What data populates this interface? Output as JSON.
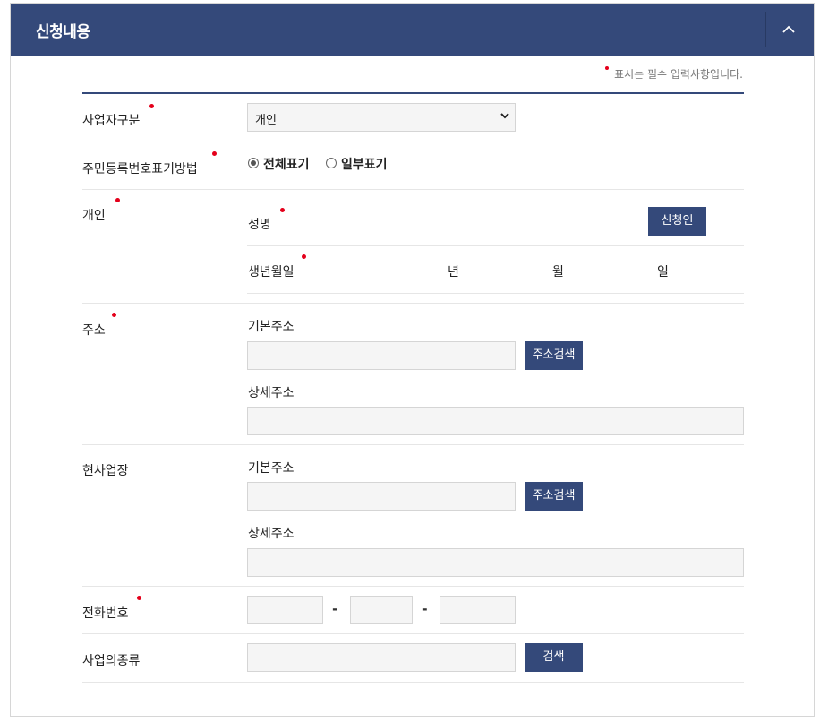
{
  "header": {
    "title": "신청내용",
    "collapse_icon": "chevron-up-icon"
  },
  "required_note": "표시는 필수 입력사항입니다.",
  "colors": {
    "header_bg": "#34497a",
    "button_bg": "#34497a",
    "required_dot": "#e4001b"
  },
  "business_type": {
    "label": "사업자구분",
    "selected": "개인"
  },
  "rrn_display": {
    "label": "주민등록번호표기방법",
    "options": [
      "전체표기",
      "일부표기"
    ],
    "selected": "전체표기"
  },
  "individual": {
    "label": "개인",
    "name_label": "성명",
    "applicant_button": "신청인",
    "birth_label": "생년월일",
    "year": "년",
    "month": "월",
    "day": "일"
  },
  "address": {
    "label": "주소",
    "basic_label": "기본주소",
    "search_button": "주소검색",
    "detail_label": "상세주소"
  },
  "workplace": {
    "label": "현사업장",
    "basic_label": "기본주소",
    "search_button": "주소검색",
    "detail_label": "상세주소"
  },
  "phone": {
    "label": "전화번호",
    "separator": "-"
  },
  "business_kind": {
    "label": "사업의종류",
    "search_button": "검색"
  }
}
